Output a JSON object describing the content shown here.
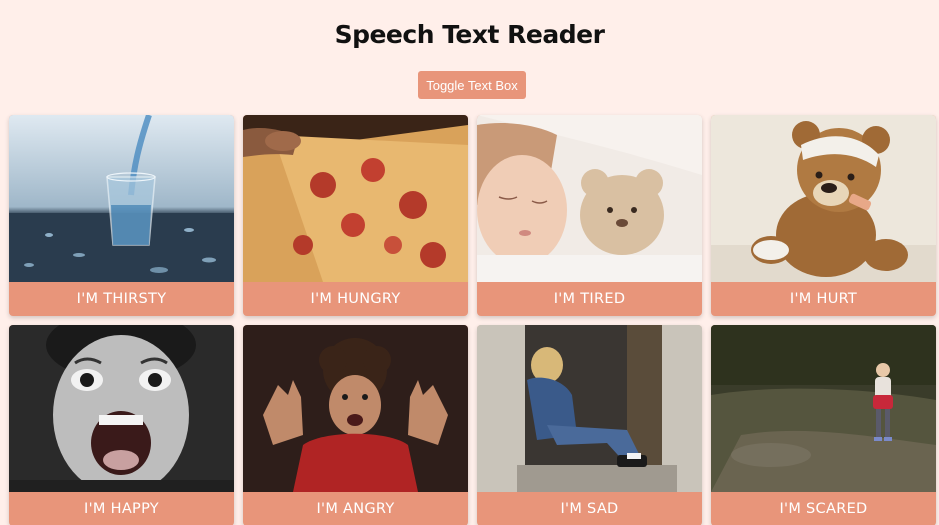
{
  "header": {
    "title": "Speech Text Reader",
    "toggle_label": "Toggle Text Box"
  },
  "cards": [
    {
      "label": "I'M THIRSTY",
      "image": "water-glass"
    },
    {
      "label": "I'M HUNGRY",
      "image": "pizza-slice"
    },
    {
      "label": "I'M TIRED",
      "image": "sleeping-child"
    },
    {
      "label": "I'M HURT",
      "image": "bandaged-teddy-bear"
    },
    {
      "label": "I'M HAPPY",
      "image": "excited-boy"
    },
    {
      "label": "I'M ANGRY",
      "image": "angry-boy"
    },
    {
      "label": "I'M SAD",
      "image": "sad-girl-in-doorway"
    },
    {
      "label": "I'M SCARED",
      "image": "girl-in-forest"
    }
  ],
  "colors": {
    "background": "#ffefea",
    "accent": "#e8957a",
    "label_text": "#ffffff"
  }
}
